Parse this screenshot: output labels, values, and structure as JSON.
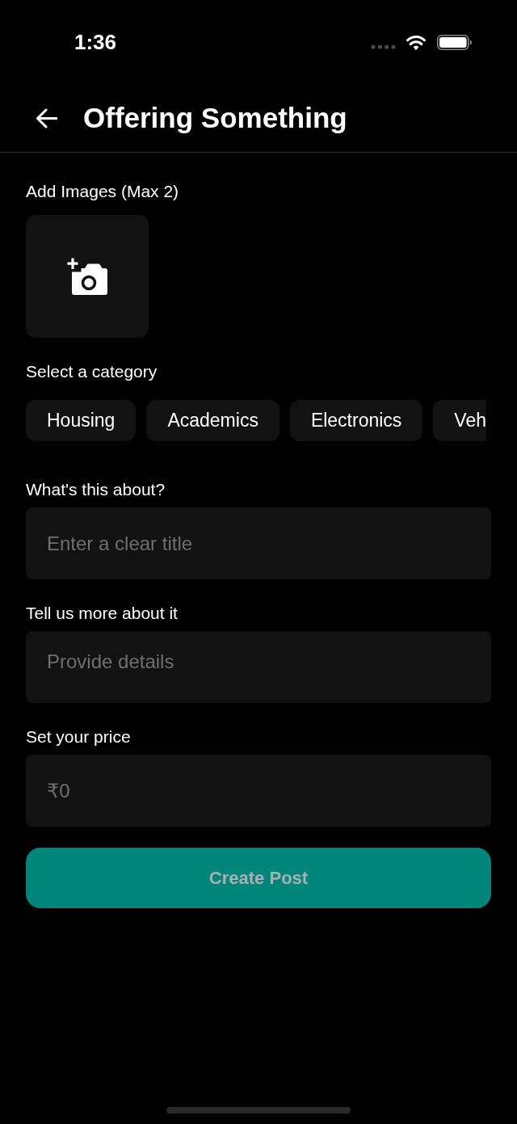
{
  "status_bar": {
    "time": "1:36"
  },
  "header": {
    "title": "Offering Something"
  },
  "images": {
    "label": "Add Images (Max 2)"
  },
  "category": {
    "label": "Select a category",
    "chips": [
      {
        "label": "Housing",
        "selected": false
      },
      {
        "label": "Academics",
        "selected": false
      },
      {
        "label": "Electronics",
        "selected": false
      },
      {
        "label": "Veh",
        "selected": false
      }
    ]
  },
  "fields": [
    {
      "kind": "text",
      "label": "What's this about?",
      "placeholder": "Enter a clear title"
    },
    {
      "kind": "multiline",
      "label": "Tell us more about it",
      "placeholder": "Provide details"
    },
    {
      "kind": "text",
      "label": "Set your price",
      "placeholder": "₹0"
    }
  ],
  "submit": {
    "label": "Create Post",
    "disabled": true
  }
}
